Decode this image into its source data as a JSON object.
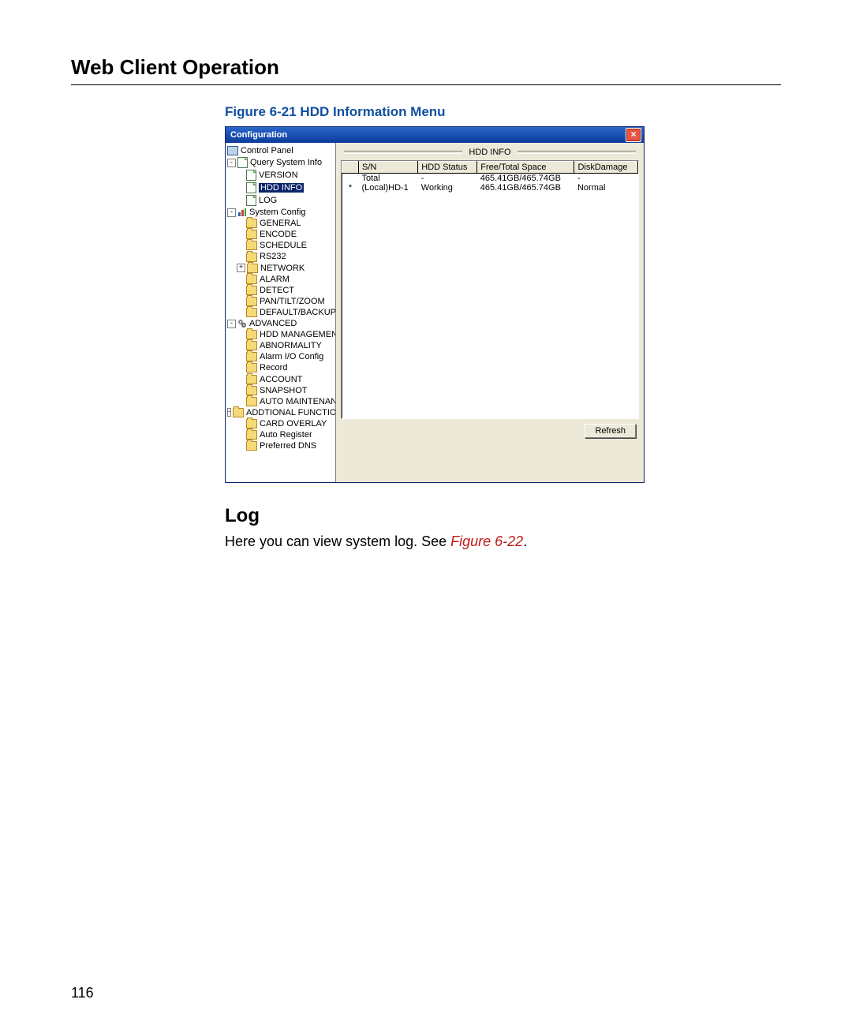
{
  "page": {
    "heading": "Web Client Operation",
    "figure_caption": "Figure 6-21 HDD Information Menu",
    "subheading": "Log",
    "body_text_pre": "Here you can view system log. See ",
    "body_fig_ref": "Figure 6-22",
    "body_text_post": ".",
    "page_number": "116"
  },
  "window": {
    "title": "Configuration",
    "close": "×",
    "section_title": "HDD INFO",
    "refresh_label": "Refresh"
  },
  "tree": {
    "control_panel": "Control Panel",
    "query": "Query System Info",
    "version": "VERSION",
    "hdd_info": "HDD INFO",
    "log": "LOG",
    "system_config": "System Config",
    "general": "GENERAL",
    "encode": "ENCODE",
    "schedule": "SCHEDULE",
    "rs232": "RS232",
    "network": "NETWORK",
    "alarm": "ALARM",
    "detect": "DETECT",
    "ptz": "PAN/TILT/ZOOM",
    "default_backup": "DEFAULT/BACKUP",
    "advanced": "ADVANCED",
    "hdd_management": "HDD MANAGEMENT",
    "abnormality": "ABNORMALITY",
    "alarm_io": "Alarm I/O Config",
    "record": "Record",
    "account": "ACCOUNT",
    "snapshot": "SNAPSHOT",
    "auto_maint": "AUTO MAINTENANCE",
    "additional": "ADDTIONAL FUNCTION",
    "card_overlay": "CARD OVERLAY",
    "auto_register": "Auto Register",
    "pref_dns": "Preferred DNS"
  },
  "table": {
    "headers": {
      "sn": "S/N",
      "status": "HDD Status",
      "space": "Free/Total Space",
      "damage": "DiskDamage"
    },
    "rows": [
      {
        "pre": "",
        "sn": "Total",
        "status": "-",
        "space": "465.41GB/465.74GB",
        "damage": "-"
      },
      {
        "pre": "*",
        "sn": "(Local)HD-1",
        "status": "Working",
        "space": "465.41GB/465.74GB",
        "damage": "Normal"
      }
    ]
  }
}
